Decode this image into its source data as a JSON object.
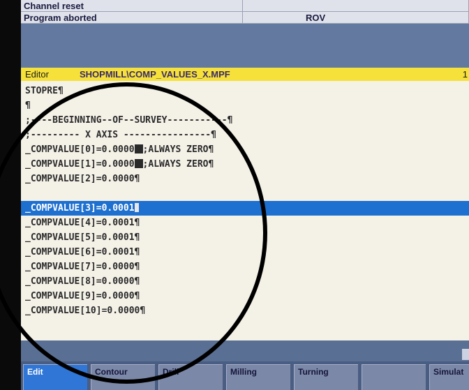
{
  "status": {
    "line1": "Channel reset",
    "line2": "Program aborted",
    "rov": "ROV"
  },
  "editor": {
    "label": "Editor",
    "path": "SHOPMILL\\COMP_VALUES_X.MPF",
    "page_marker": "1"
  },
  "lines": [
    "STOPRE¶",
    "¶",
    ";----BEGINNING--OF--SURVEY-----------¶",
    ";--------- X AXIS ----------------¶",
    "_COMPVALUE[0]=0.0000",
    "_COMPVALUE[1]=0.0000",
    "_COMPVALUE[2]=0.0000¶",
    "_COMPVALUE[3]=0.0001",
    "_COMPVALUE[4]=0.0001¶",
    "_COMPVALUE[5]=0.0001¶",
    "_COMPVALUE[6]=0.0001¶",
    "_COMPVALUE[7]=0.0000¶",
    "_COMPVALUE[8]=0.0000¶",
    "_COMPVALUE[9]=0.0000¶",
    "_COMPVALUE[10]=0.0000¶"
  ],
  "line_suffix": {
    "l4": ";ALWAYS ZERO¶",
    "l5": ";ALWAYS ZERO¶",
    "l7": "¶"
  },
  "softkeys": [
    "Edit",
    "Contour",
    "Drill",
    "Milling",
    "Turning",
    "",
    "Simulat"
  ],
  "colors": {
    "header_yellow": "#f5e13a",
    "selection_blue": "#1d6fd0",
    "screen_blue": "#5a6f94"
  }
}
